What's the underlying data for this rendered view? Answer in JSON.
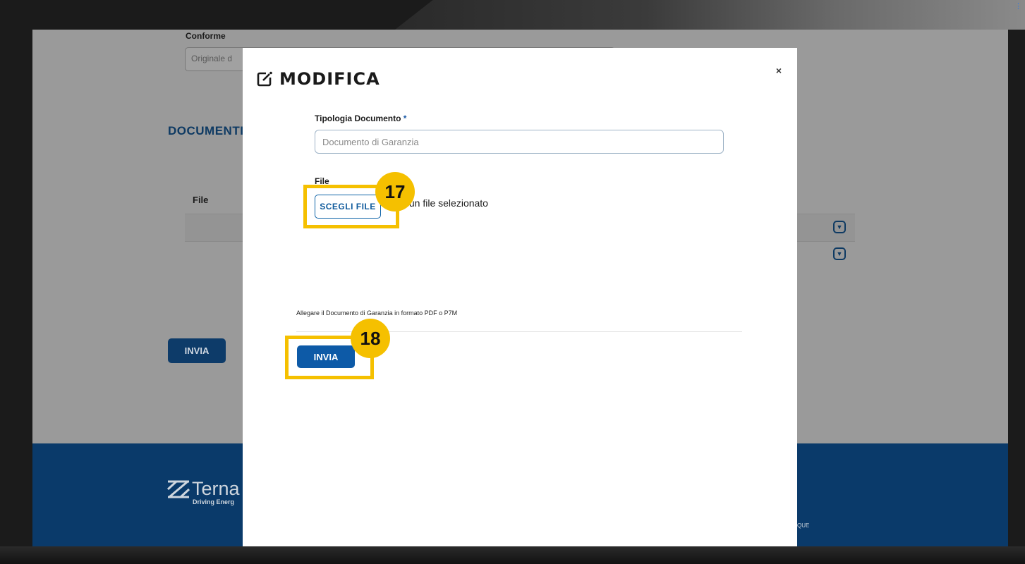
{
  "background_page": {
    "conforme_label": "Conforme",
    "conforme_value": "Originale d",
    "section_heading": "DOCUMENTI",
    "table_header_file": "File",
    "submit_label": "INVIA",
    "footer": {
      "logo_text": "Terna",
      "logo_tagline": "Driving Energ",
      "small_text": "QUE"
    }
  },
  "modal": {
    "title": "MODIFICA",
    "close_label": "×",
    "tipologia_label": "Tipologia Documento",
    "required_mark": "*",
    "tipologia_placeholder": "Documento di Garanzia",
    "file_label": "File",
    "choose_file_label": "SCEGLI FILE",
    "file_status": "Nessun file selezionato",
    "hint": "Allegare il Documento di Garanzia in formato PDF o P7M",
    "submit_label": "INVIA"
  },
  "callouts": {
    "step_17": "17",
    "step_18": "18"
  },
  "colors": {
    "accent": "#0d5aa7",
    "highlight": "#f5c000",
    "footer": "#0a3a6a"
  }
}
